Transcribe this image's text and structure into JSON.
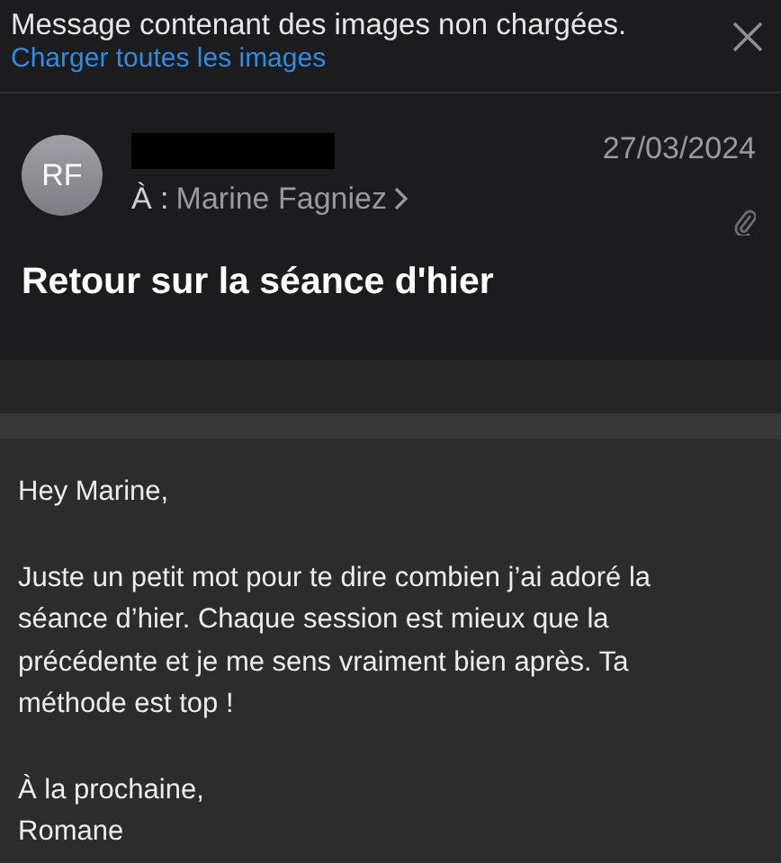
{
  "banner": {
    "message": "Message contenant des images non chargées.",
    "link": "Charger toutes les images"
  },
  "header": {
    "avatar_initials": "RF",
    "to_label": "À :",
    "recipient": "Marine Fagniez",
    "date": "27/03/2024",
    "has_attachment": true
  },
  "subject": "Retour sur la séance d'hier",
  "body": {
    "greeting": "Hey Marine,",
    "paragraph_lines": [
      "Juste un petit mot pour te dire combien j’ai adoré la",
      "séance d’hier. Chaque session est mieux que la",
      "précédente et je me sens vraiment bien après. Ta",
      "méthode est top !"
    ],
    "closing": "À la prochaine,",
    "signature": "Romane"
  }
}
